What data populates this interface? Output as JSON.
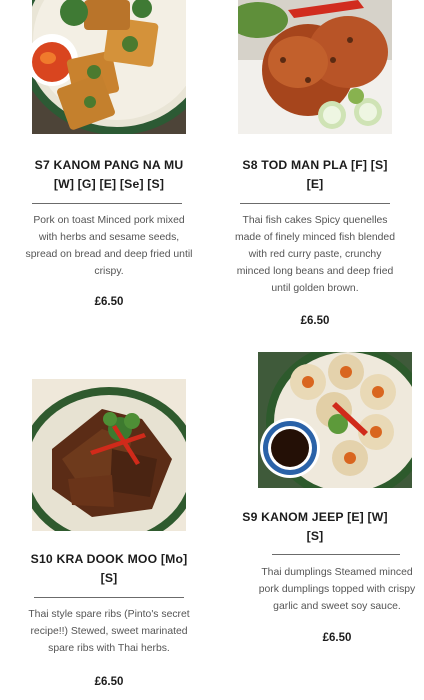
{
  "menu_items": [
    {
      "code_title_line1": "S7 KANOM PANG NA MU",
      "code_title_line2": "[W] [G] [E] [Se] [S]",
      "description_lines": [
        "Pork on toast Minced pork mixed",
        "with herbs and sesame seeds,",
        "spread on bread and deep fried until",
        "crispy."
      ],
      "price": "£6.50",
      "image_icon": "prawn-toast-photo"
    },
    {
      "code_title_line1": "S8 TOD MAN PLA [F] [S]",
      "code_title_line2": "[E]",
      "description_lines": [
        "Thai fish cakes Spicy quenelles",
        "made of finely minced fish blended",
        "with red curry paste, crunchy",
        "minced long beans and deep fried",
        "until golden brown."
      ],
      "price": "£6.50",
      "image_icon": "fish-cakes-photo"
    },
    {
      "code_title_line1": "S9 KANOM JEEP [E] [W]",
      "code_title_line2": "[S]",
      "description_lines": [
        "Thai dumplings Steamed minced",
        "pork dumplings topped with crispy",
        "garlic and sweet soy sauce."
      ],
      "price": "£6.50",
      "image_icon": "dumplings-photo"
    },
    {
      "code_title_line1": "S10 KRA DOOK MOO [Mo]",
      "code_title_line2": "[S]",
      "description_lines": [
        "Thai style spare ribs (Pinto's secret",
        "recipe!!) Stewed, sweet marinated",
        "spare ribs with Thai herbs."
      ],
      "price": "£6.50",
      "image_icon": "spare-ribs-photo"
    }
  ],
  "colors": {
    "title": "#1c1c1c",
    "description": "#555555",
    "divider": "#6b6b6b",
    "plate_green": "#2f5a2e"
  }
}
